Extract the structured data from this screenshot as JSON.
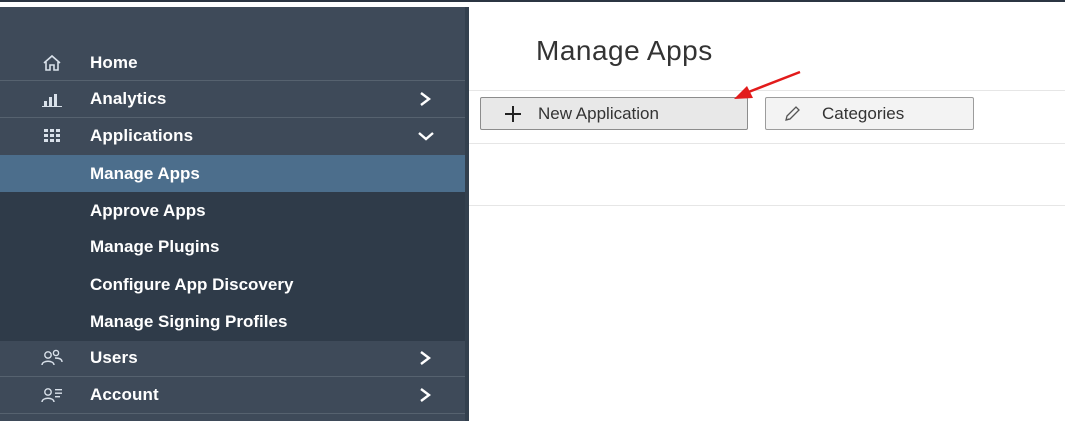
{
  "sidebar": {
    "items": [
      {
        "label": "Home",
        "icon": "home-icon"
      },
      {
        "label": "Analytics",
        "icon": "bar-chart-icon",
        "arrow": "chevron-right-icon"
      },
      {
        "label": "Applications",
        "icon": "grid-icon",
        "arrow": "chevron-down-icon"
      },
      {
        "label": "Users",
        "icon": "users-icon",
        "arrow": "chevron-right-icon"
      },
      {
        "label": "Account",
        "icon": "account-icon",
        "arrow": "chevron-right-icon"
      }
    ],
    "sub_items": [
      {
        "label": "Manage Apps",
        "active": true
      },
      {
        "label": "Approve Apps"
      },
      {
        "label": "Manage Plugins"
      },
      {
        "label": "Configure App Discovery"
      },
      {
        "label": "Manage Signing Profiles"
      }
    ]
  },
  "main": {
    "title": "Manage Apps",
    "toolbar": {
      "new_application_label": "New Application",
      "new_application_icon": "plus-icon",
      "categories_label": "Categories",
      "categories_icon": "pencil-icon"
    }
  },
  "colors": {
    "sidebar_bg": "#3e4a59",
    "submenu_bg": "#2f3b49",
    "active_item_bg": "#4c6e8c",
    "annotation_arrow": "#e21b1b"
  }
}
